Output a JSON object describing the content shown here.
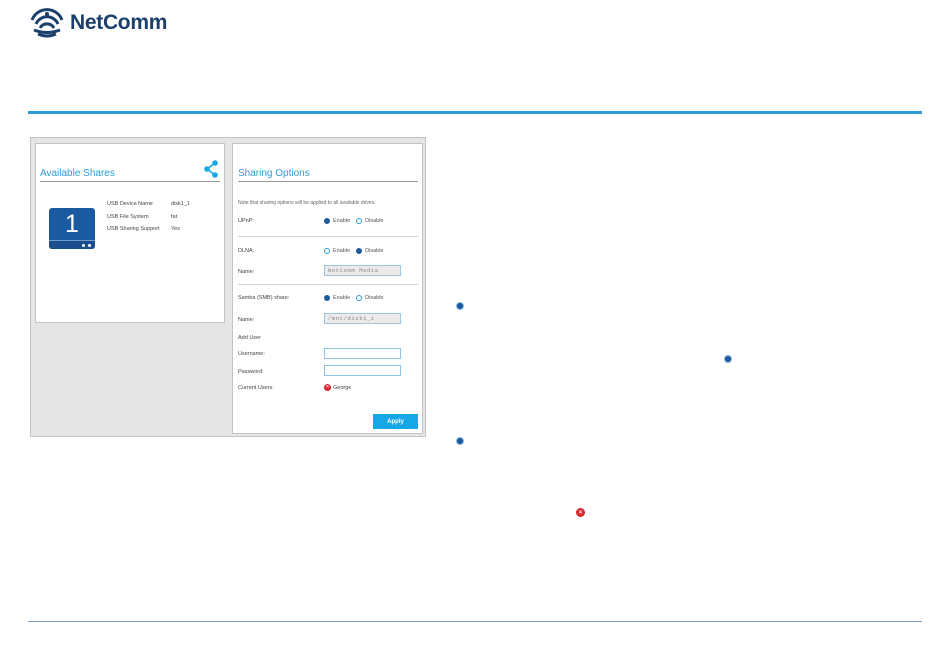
{
  "brand": {
    "name": "NetComm",
    "color": "#1a3f6b",
    "accent": "#2e9bd6"
  },
  "available_shares": {
    "title": "Available Shares",
    "disk_number": "1",
    "rows": [
      {
        "label": "USB Device Name",
        "value": "disk1_1"
      },
      {
        "label": "USB File System",
        "value": "fat"
      },
      {
        "label": "USB Sharing Support",
        "value": "Yes"
      }
    ]
  },
  "sharing_options": {
    "title": "Sharing Options",
    "note": "Note that sharing options will be applied to all available drives.",
    "enable_label": "Enable",
    "disable_label": "Disable",
    "upnp": {
      "label": "UPnP:",
      "selected": "Enable"
    },
    "dlna": {
      "label": "DLNA:",
      "selected": "Disable",
      "name_label": "Name:",
      "name_value": "NetComm Media"
    },
    "samba": {
      "label": "Samba (SMB) share:",
      "selected": "Enable",
      "name_label": "Name:",
      "name_value": "/mnt/disk1_1"
    },
    "add_user": {
      "label": "Add User",
      "username_label": "Username:",
      "username_value": "",
      "password_label": "Password:",
      "password_value": ""
    },
    "current_users": {
      "label": "Current Users:",
      "users": [
        "George"
      ]
    },
    "apply_label": "Apply"
  },
  "icons": {
    "share": "share-icon",
    "wifi": "wifi-logo-icon",
    "bullet": "radio-bullet-icon",
    "remove": "remove-x-icon"
  }
}
